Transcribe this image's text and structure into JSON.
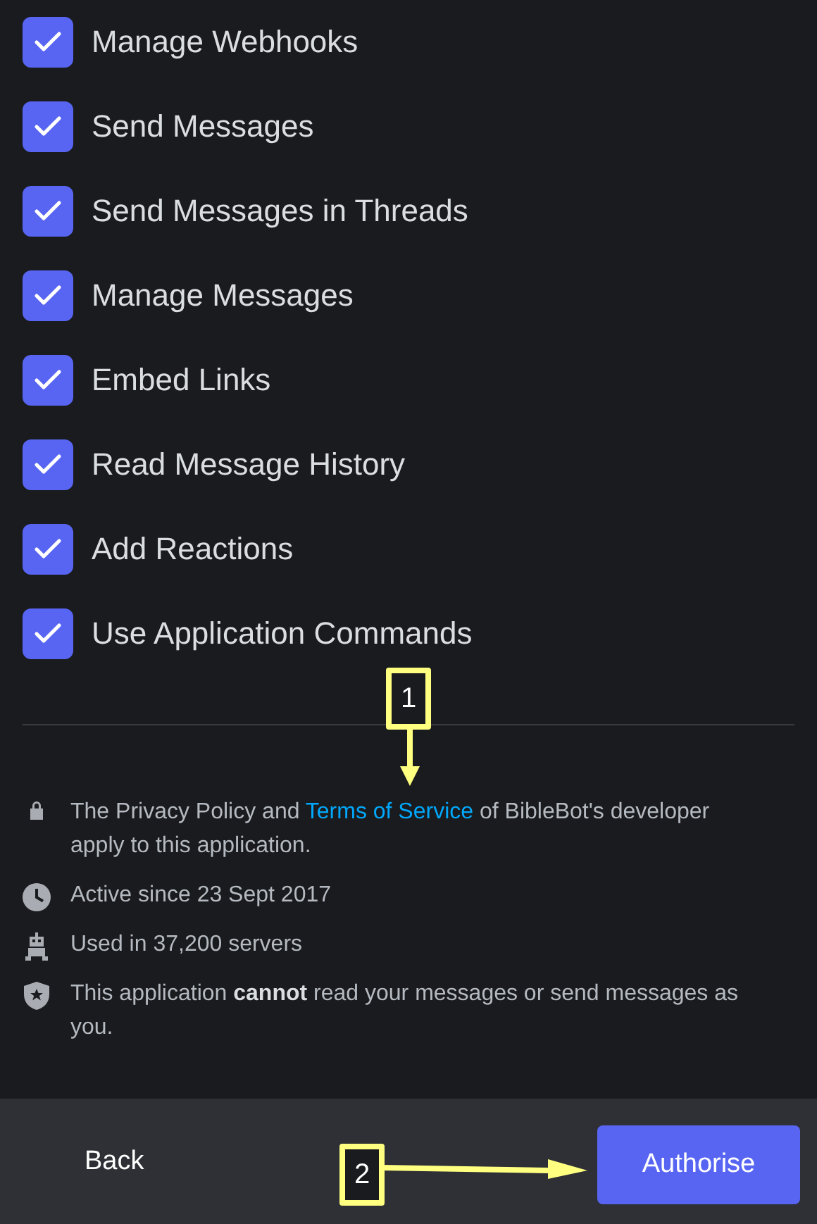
{
  "permissions": [
    {
      "label": "Manage Webhooks",
      "checked": true
    },
    {
      "label": "Send Messages",
      "checked": true
    },
    {
      "label": "Send Messages in Threads",
      "checked": true
    },
    {
      "label": "Manage Messages",
      "checked": true
    },
    {
      "label": "Embed Links",
      "checked": true
    },
    {
      "label": "Read Message History",
      "checked": true
    },
    {
      "label": "Add Reactions",
      "checked": true
    },
    {
      "label": "Use Application Commands",
      "checked": true
    }
  ],
  "info": [
    {
      "kind": "lock",
      "text_before": "The Privacy Policy and",
      "link": "Terms of Service",
      "text_after": "of BibleBot's developer apply to this application."
    },
    {
      "kind": "clock",
      "text": "Active since 23 Sept 2017"
    },
    {
      "kind": "robot",
      "text": "Used in 37,200 servers"
    },
    {
      "kind": "shield",
      "text": "This application **cannot** read your messages or send messages as you."
    }
  ],
  "footer": {
    "back": "Back",
    "authorise": "Authorise"
  },
  "annotations": [
    {
      "label": "1",
      "kind": "down"
    },
    {
      "label": "2",
      "kind": "right"
    }
  ]
}
